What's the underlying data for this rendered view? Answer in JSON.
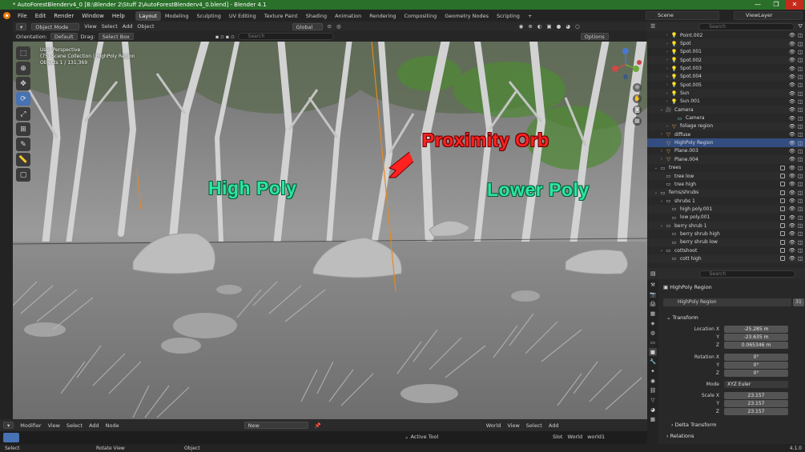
{
  "window": {
    "title": "* AutoForestBlenderv4_0 [B:\\Blender 2\\Stuff 2\\AutoForestBlenderv4_0.blend] - Blender 4.1",
    "minimize": "—",
    "maximize": "❐",
    "close": "✕"
  },
  "menu": {
    "items": [
      "File",
      "Edit",
      "Render",
      "Window",
      "Help"
    ],
    "workspaces": [
      "Layout",
      "Modeling",
      "Sculpting",
      "UV Editing",
      "Texture Paint",
      "Shading",
      "Animation",
      "Rendering",
      "Compositing",
      "Geometry Nodes",
      "Scripting"
    ],
    "active_workspace": "Layout",
    "add_workspace": "+",
    "scene": "Scene",
    "view_layer": "ViewLayer"
  },
  "viewport_header": {
    "mode": "Object Mode",
    "view": "View",
    "select": "Select",
    "add": "Add",
    "object": "Object",
    "orientation_label": "Orientation:",
    "orientation": "Default",
    "drag_label": "Drag:",
    "drag": "Select Box",
    "transform_orientation": "Global",
    "options": "Options",
    "search_placeholder": "Search"
  },
  "viewport_info": {
    "line1": "User Perspective",
    "line2": "(75) Scene Collection | HighPoly Region",
    "line3": "Objects    1 / 131,369"
  },
  "annotations": {
    "high_poly": "High Poly",
    "proximity_orb": "Proximity Orb",
    "lower_poly": "Lower Poly"
  },
  "outliner": {
    "search_placeholder": "Search",
    "rows": [
      {
        "label": "Point.002",
        "indent": 3,
        "icon": "light",
        "arrow": "›"
      },
      {
        "label": "Spot",
        "indent": 3,
        "icon": "light",
        "arrow": "›"
      },
      {
        "label": "Spot.001",
        "indent": 3,
        "icon": "light",
        "arrow": "›"
      },
      {
        "label": "Spot.002",
        "indent": 3,
        "icon": "light",
        "arrow": "›"
      },
      {
        "label": "Spot.003",
        "indent": 3,
        "icon": "light",
        "arrow": "›"
      },
      {
        "label": "Spot.004",
        "indent": 3,
        "icon": "light",
        "arrow": "›"
      },
      {
        "label": "Spot.005",
        "indent": 3,
        "icon": "light",
        "arrow": "›"
      },
      {
        "label": "Sun",
        "indent": 3,
        "icon": "light",
        "arrow": "›"
      },
      {
        "label": "Sun.001",
        "indent": 3,
        "icon": "light",
        "arrow": "›"
      },
      {
        "label": "Camera",
        "indent": 2,
        "icon": "camera",
        "arrow": "⌄"
      },
      {
        "label": "Camera",
        "indent": 4,
        "icon": "camera-data",
        "arrow": ""
      },
      {
        "label": "foliage region",
        "indent": 3,
        "icon": "mesh",
        "arrow": "›"
      },
      {
        "label": "diffuse",
        "indent": 2,
        "icon": "mesh",
        "arrow": "›"
      },
      {
        "label": "HighPoly Region",
        "indent": 2,
        "icon": "mesh",
        "arrow": "",
        "selected": true
      },
      {
        "label": "Plane.003",
        "indent": 2,
        "icon": "mesh",
        "arrow": "›"
      },
      {
        "label": "Plane.004",
        "indent": 2,
        "icon": "mesh",
        "arrow": "›"
      },
      {
        "label": "trees",
        "indent": 1,
        "icon": "collection",
        "arrow": "⌄"
      },
      {
        "label": "tree low",
        "indent": 2,
        "icon": "collection",
        "arrow": ""
      },
      {
        "label": "tree high",
        "indent": 2,
        "icon": "collection",
        "arrow": ""
      },
      {
        "label": "ferns/shrubs",
        "indent": 1,
        "icon": "collection",
        "arrow": "⌄"
      },
      {
        "label": "shrubs 1",
        "indent": 2,
        "icon": "collection",
        "arrow": "⌄"
      },
      {
        "label": "high poly.001",
        "indent": 3,
        "icon": "collection",
        "arrow": ""
      },
      {
        "label": "low poly.001",
        "indent": 3,
        "icon": "collection",
        "arrow": ""
      },
      {
        "label": "berry shrub 1",
        "indent": 2,
        "icon": "collection",
        "arrow": "⌄"
      },
      {
        "label": "berry shrub high",
        "indent": 3,
        "icon": "collection",
        "arrow": ""
      },
      {
        "label": "berry shrub low",
        "indent": 3,
        "icon": "collection",
        "arrow": ""
      },
      {
        "label": "cottshoot",
        "indent": 2,
        "icon": "collection",
        "arrow": "⌄"
      },
      {
        "label": "cott high",
        "indent": 3,
        "icon": "collection",
        "arrow": ""
      }
    ]
  },
  "properties": {
    "search_placeholder": "Search",
    "object_name": "HighPoly Region",
    "data_name": "HighPoly Region",
    "users": "31",
    "transform_label": "Transform",
    "location_label": "Location X",
    "location": [
      "-25.285 m",
      "-23.635 m",
      "0.065346 m"
    ],
    "rotation_label": "Rotation X",
    "rotation": [
      "0°",
      "0°",
      "0°"
    ],
    "mode_label": "Mode",
    "mode": "XYZ Euler",
    "scale_label": "Scale X",
    "scale": [
      "23.157",
      "23.157",
      "23.157"
    ],
    "axis_y": "Y",
    "axis_z": "Z",
    "delta_transform": "Delta Transform",
    "relations": "Relations"
  },
  "bottom": {
    "editor": "Modifier",
    "view": "View",
    "select": "Select",
    "add": "Add",
    "node": "Node",
    "new": "New",
    "world": "World",
    "view2": "View",
    "select2": "Select",
    "add2": "Add",
    "active_tool": "Active Tool",
    "slot": "Slot",
    "world_label": "World",
    "world_name": "world1"
  },
  "status": {
    "select": "Select",
    "rotate": "Rotate View",
    "object": "Object",
    "version": "4.1.0"
  }
}
